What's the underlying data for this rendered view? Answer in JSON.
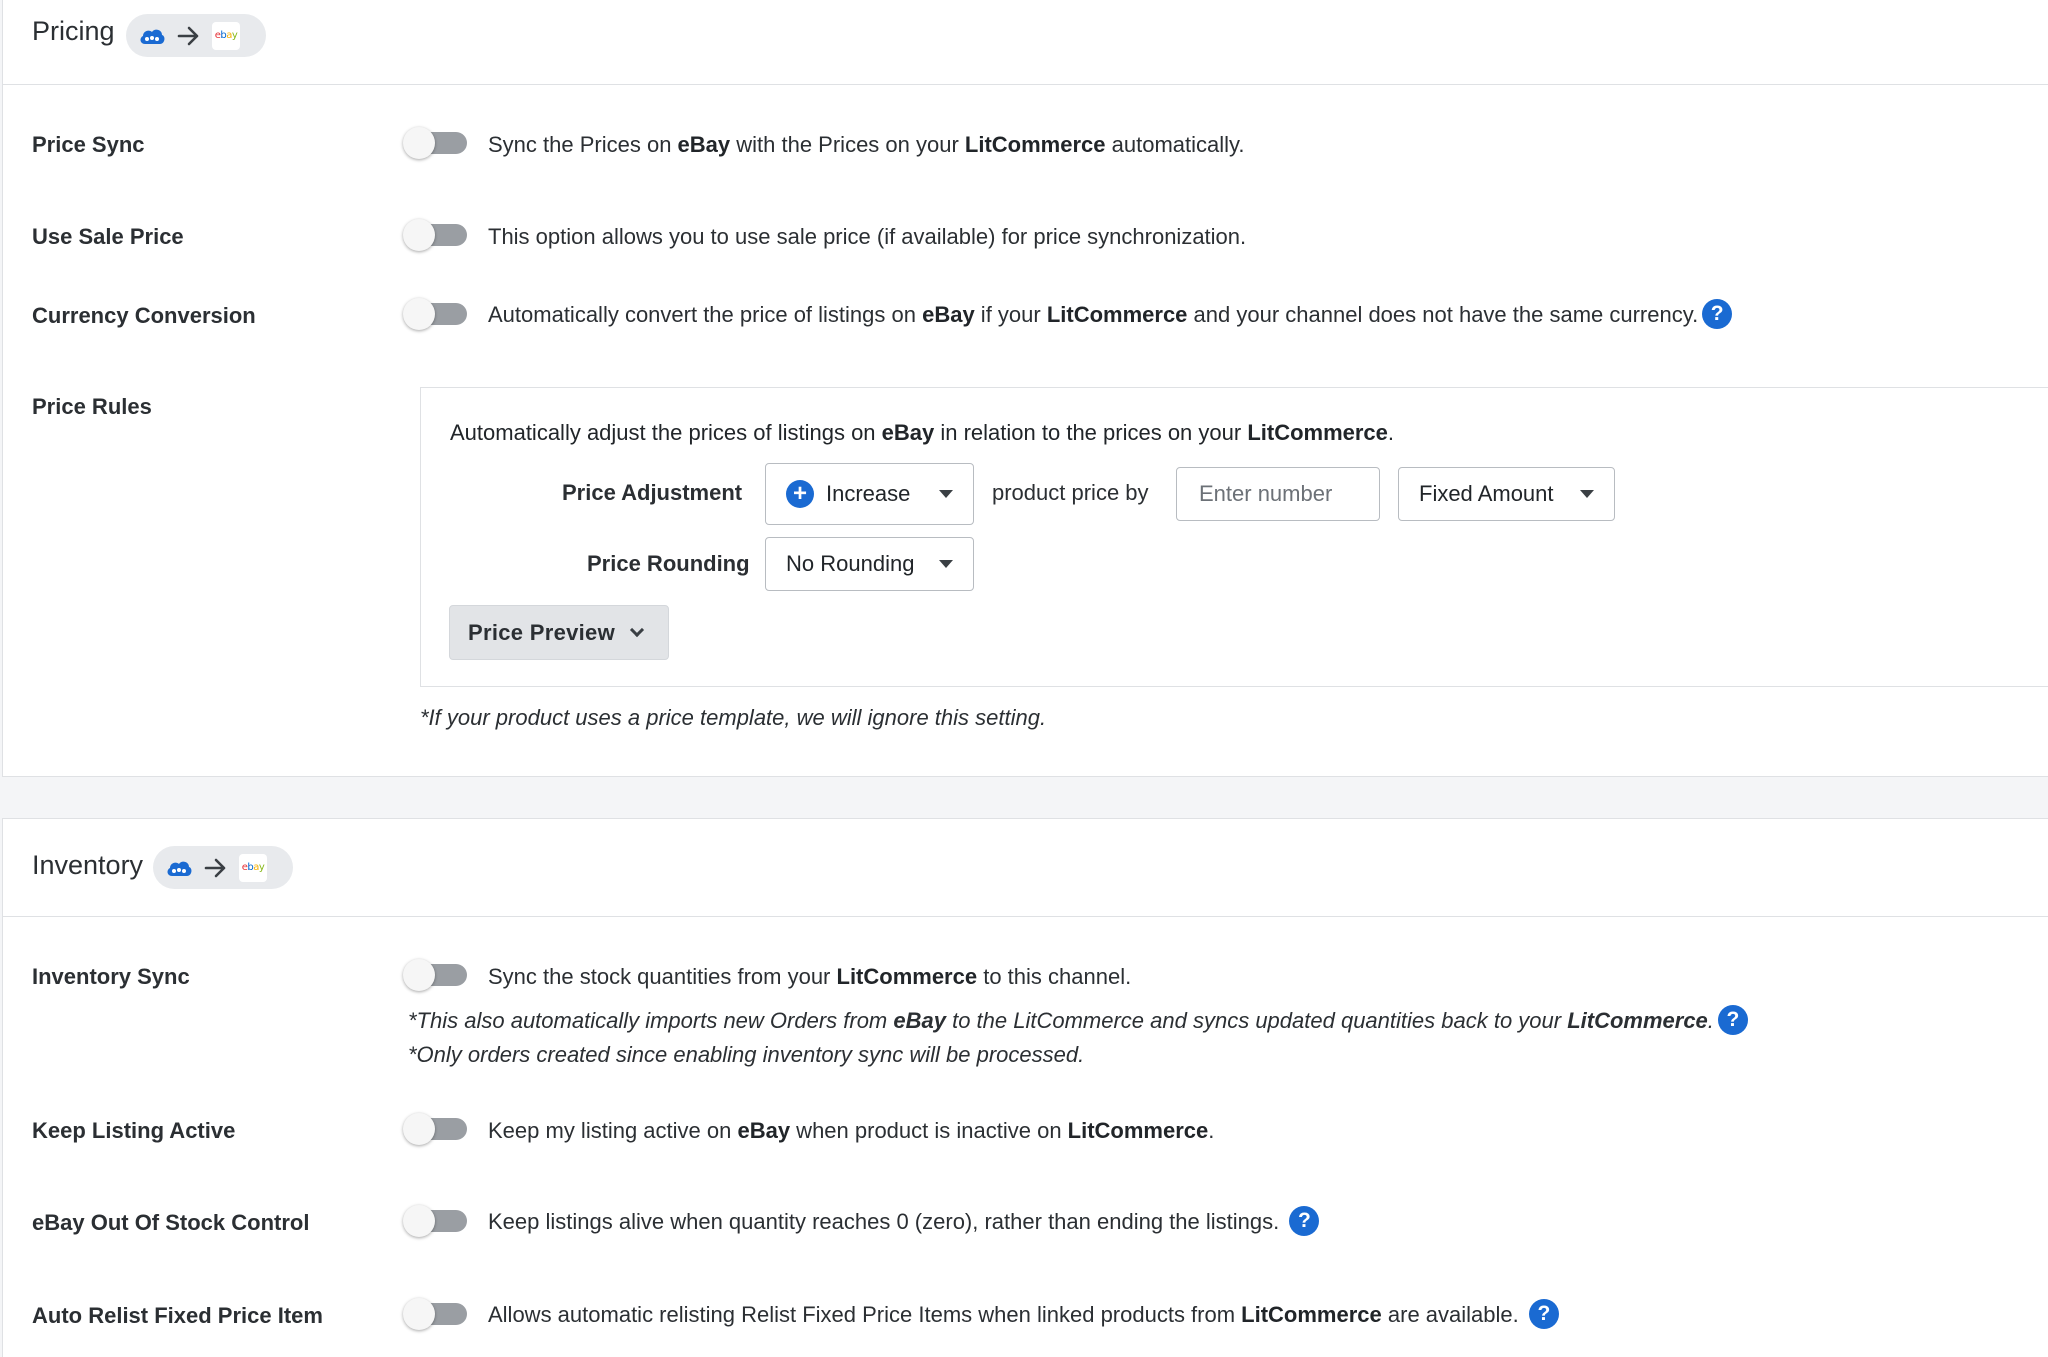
{
  "pricing": {
    "title": "Pricing",
    "rows": {
      "price_sync": {
        "label": "Price Sync",
        "pre": "Sync the Prices on ",
        "b1": "eBay",
        "mid": " with the Prices on your ",
        "b2": "LitCommerce",
        "post": " automatically."
      },
      "use_sale_price": {
        "label": "Use Sale Price",
        "desc": "This option allows you to use sale price (if available) for price synchronization."
      },
      "currency_conversion": {
        "label": "Currency Conversion",
        "pre": "Automatically convert the price of listings on ",
        "b1": "eBay",
        "mid": " if your ",
        "b2": "LitCommerce",
        "post": " and your channel does not have the same currency."
      }
    },
    "price_rules": {
      "label": "Price Rules",
      "intro_pre": "Automatically adjust the prices of listings on ",
      "intro_b1": "eBay",
      "intro_mid": " in relation to the prices on your ",
      "intro_b2": "LitCommerce",
      "intro_post": ".",
      "adjustment_label": "Price Adjustment",
      "adjustment_value": "Increase",
      "product_price_by": "product price by",
      "amount_placeholder": "Enter number",
      "amount_type": "Fixed Amount",
      "rounding_label": "Price Rounding",
      "rounding_value": "No Rounding",
      "preview_button": "Price Preview",
      "note": "*If your product uses a price template, we will ignore this setting."
    }
  },
  "inventory": {
    "title": "Inventory",
    "rows": {
      "inventory_sync": {
        "label": "Inventory Sync",
        "pre": "Sync the stock quantities from your ",
        "b1": "LitCommerce",
        "post": " to this channel.",
        "note1_pre": "*This also automatically imports new Orders from ",
        "note1_b1": "eBay",
        "note1_mid": " to the LitCommerce and syncs updated quantities back to your ",
        "note1_b2": "LitCommerce",
        "note1_post": ".",
        "note2": "*Only orders created since enabling inventory sync will be processed."
      },
      "keep_listing_active": {
        "label": "Keep Listing Active",
        "pre": "Keep my listing active on ",
        "b1": "eBay",
        "mid": " when product is inactive on ",
        "b2": "LitCommerce",
        "post": "."
      },
      "out_of_stock": {
        "label": "eBay Out Of Stock Control",
        "desc": "Keep listings alive when quantity reaches 0 (zero), rather than ending the listings."
      },
      "auto_relist": {
        "label": "Auto Relist Fixed Price Item",
        "pre": "Allows automatic relisting Relist Fixed Price Items when linked products from ",
        "b1": "LitCommerce",
        "post": " are available."
      }
    }
  },
  "icons": {
    "help": "?",
    "plus": "+",
    "ebay_logo": [
      "e",
      "b",
      "a",
      "y"
    ]
  },
  "colors": {
    "accent": "#1a6ad2",
    "toggle_off": "#9a9ea3"
  }
}
